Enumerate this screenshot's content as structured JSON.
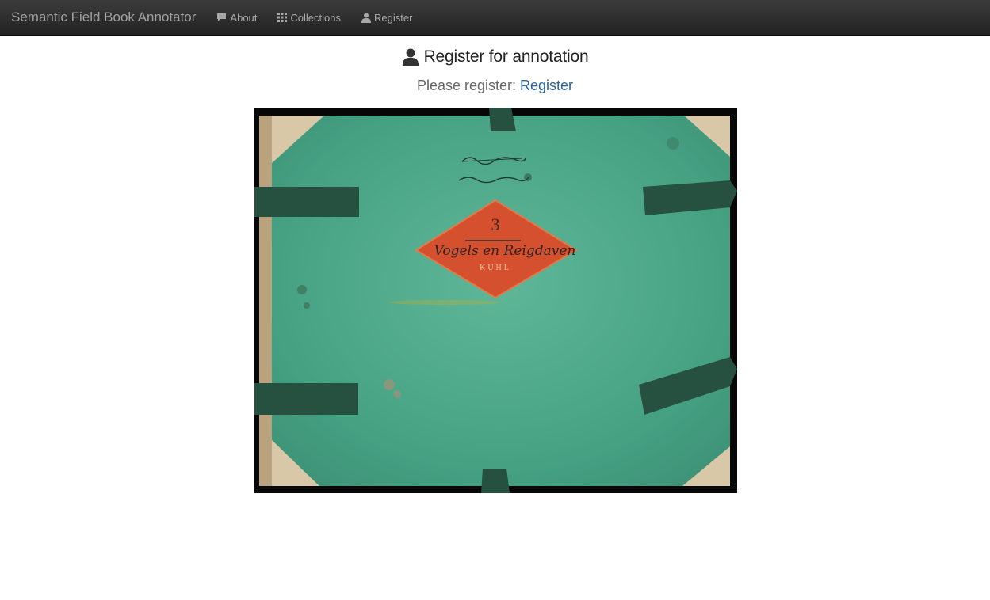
{
  "navbar": {
    "brand": "Semantic Field Book Annotator",
    "items": [
      {
        "label": "About",
        "icon": "comment-icon"
      },
      {
        "label": "Collections",
        "icon": "grid-icon"
      },
      {
        "label": "Register",
        "icon": "user-icon"
      }
    ]
  },
  "main": {
    "heading": "Register for annotation",
    "prompt": "Please register: ",
    "register_link": "Register",
    "image": {
      "label_number": "3",
      "label_script": "Vogels en Reigdaven",
      "label_name": "KUHL",
      "handwriting_top": "Gerund",
      "handwriting_bottom": "Gewerkes"
    }
  },
  "colors": {
    "navbar": "#2b2b2b",
    "link": "#2a6496",
    "cover_green": "#4fa98b",
    "label_red": "#d5502e"
  }
}
